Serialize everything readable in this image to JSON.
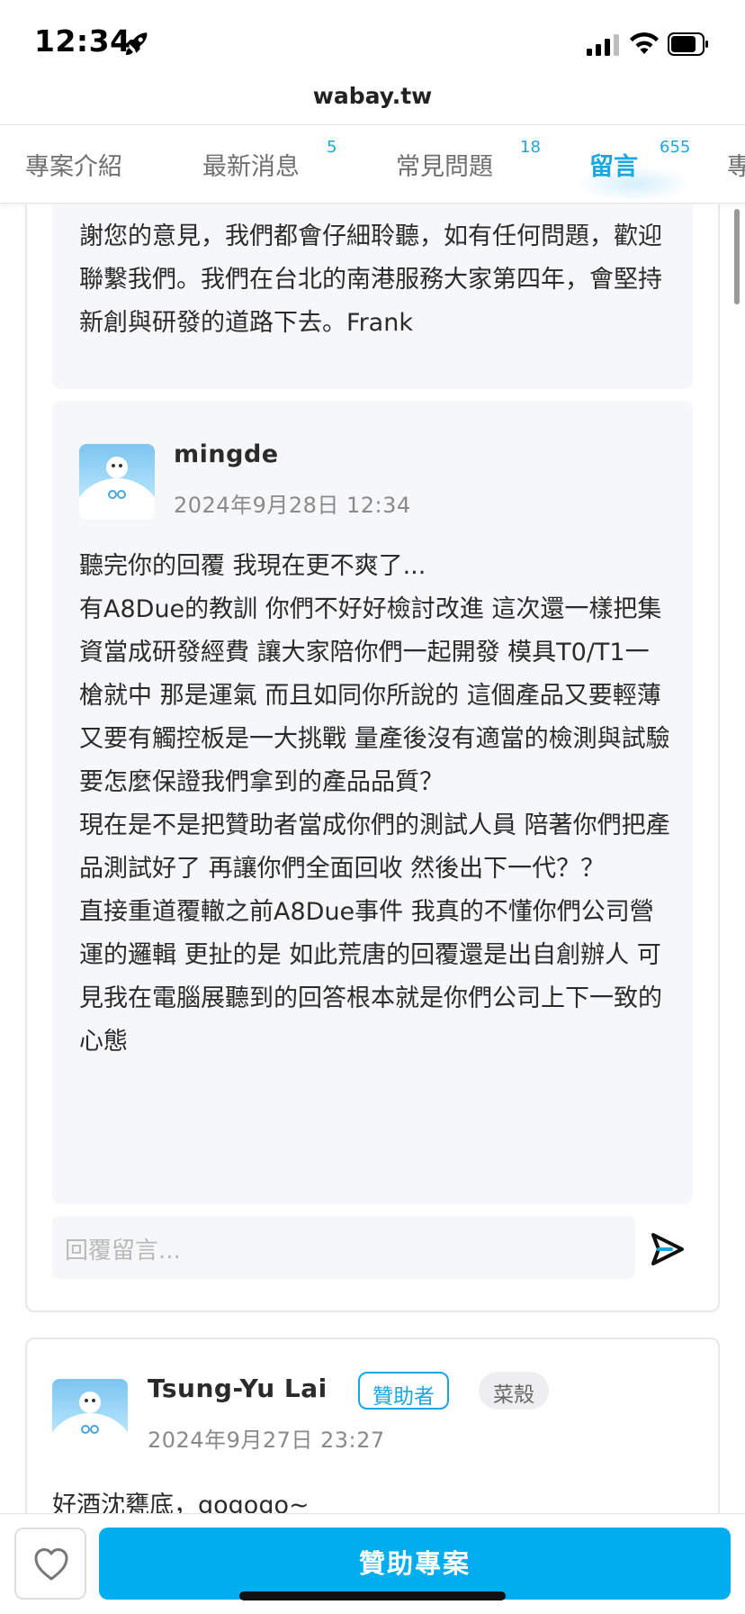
{
  "status_bar": {
    "time": "12:34"
  },
  "url_bar": {
    "url": "wabay.tw"
  },
  "tabs": [
    {
      "label": "專案介紹",
      "count": ""
    },
    {
      "label": "最新消息",
      "count": "5"
    },
    {
      "label": "常見問題",
      "count": "18"
    },
    {
      "label": "留言",
      "count": "655",
      "active": true
    },
    {
      "label": "專",
      "count": ""
    }
  ],
  "thread": {
    "reply_creator_text": "謝您的意見，我們都會仔細聆聽，如有任何問題，歡迎聯繫我們。我們在台北的南港服務大家第四年，會堅持新創與研發的道路下去。Frank",
    "reply": {
      "user": "mingde",
      "date": "2024年9月28日 12:34",
      "lines": [
        "聽完你的回覆 我現在更不爽了...",
        "有A8Due的教訓 你們不好好檢討改進 這次還一樣把集資當成研發經費 讓大家陪你們一起開發 模具T0/T1一槍就中 那是運氣 而且如同你所說的 這個產品又要輕薄又要有觸控板是一大挑戰 量產後沒有適當的檢測與試驗要怎麼保證我們拿到的產品品質？",
        "現在是不是把贊助者當成你們的測試人員 陪著你們把產品測試好了 再讓你們全面回收 然後出下一代？？",
        "直接重道覆轍之前A8Due事件 我真的不懂你們公司營運的邏輯 更扯的是 如此荒唐的回覆還是出自創辦人 可見我在電腦展聽到的回答根本就是你們公司上下一致的心態"
      ]
    },
    "reply_input_placeholder": "回覆留言..."
  },
  "comment": {
    "user": "Tsung-Yu Lai",
    "badge_sponsor": "贊助者",
    "badge_rank": "菜殼",
    "date": "2024年9月27日 23:27",
    "body": "好酒沈甕底，gogogo~"
  },
  "bottom_bar": {
    "sponsor_label": "贊助專案"
  },
  "colors": {
    "accent": "#1aa7e0",
    "button": "#00aef0"
  }
}
